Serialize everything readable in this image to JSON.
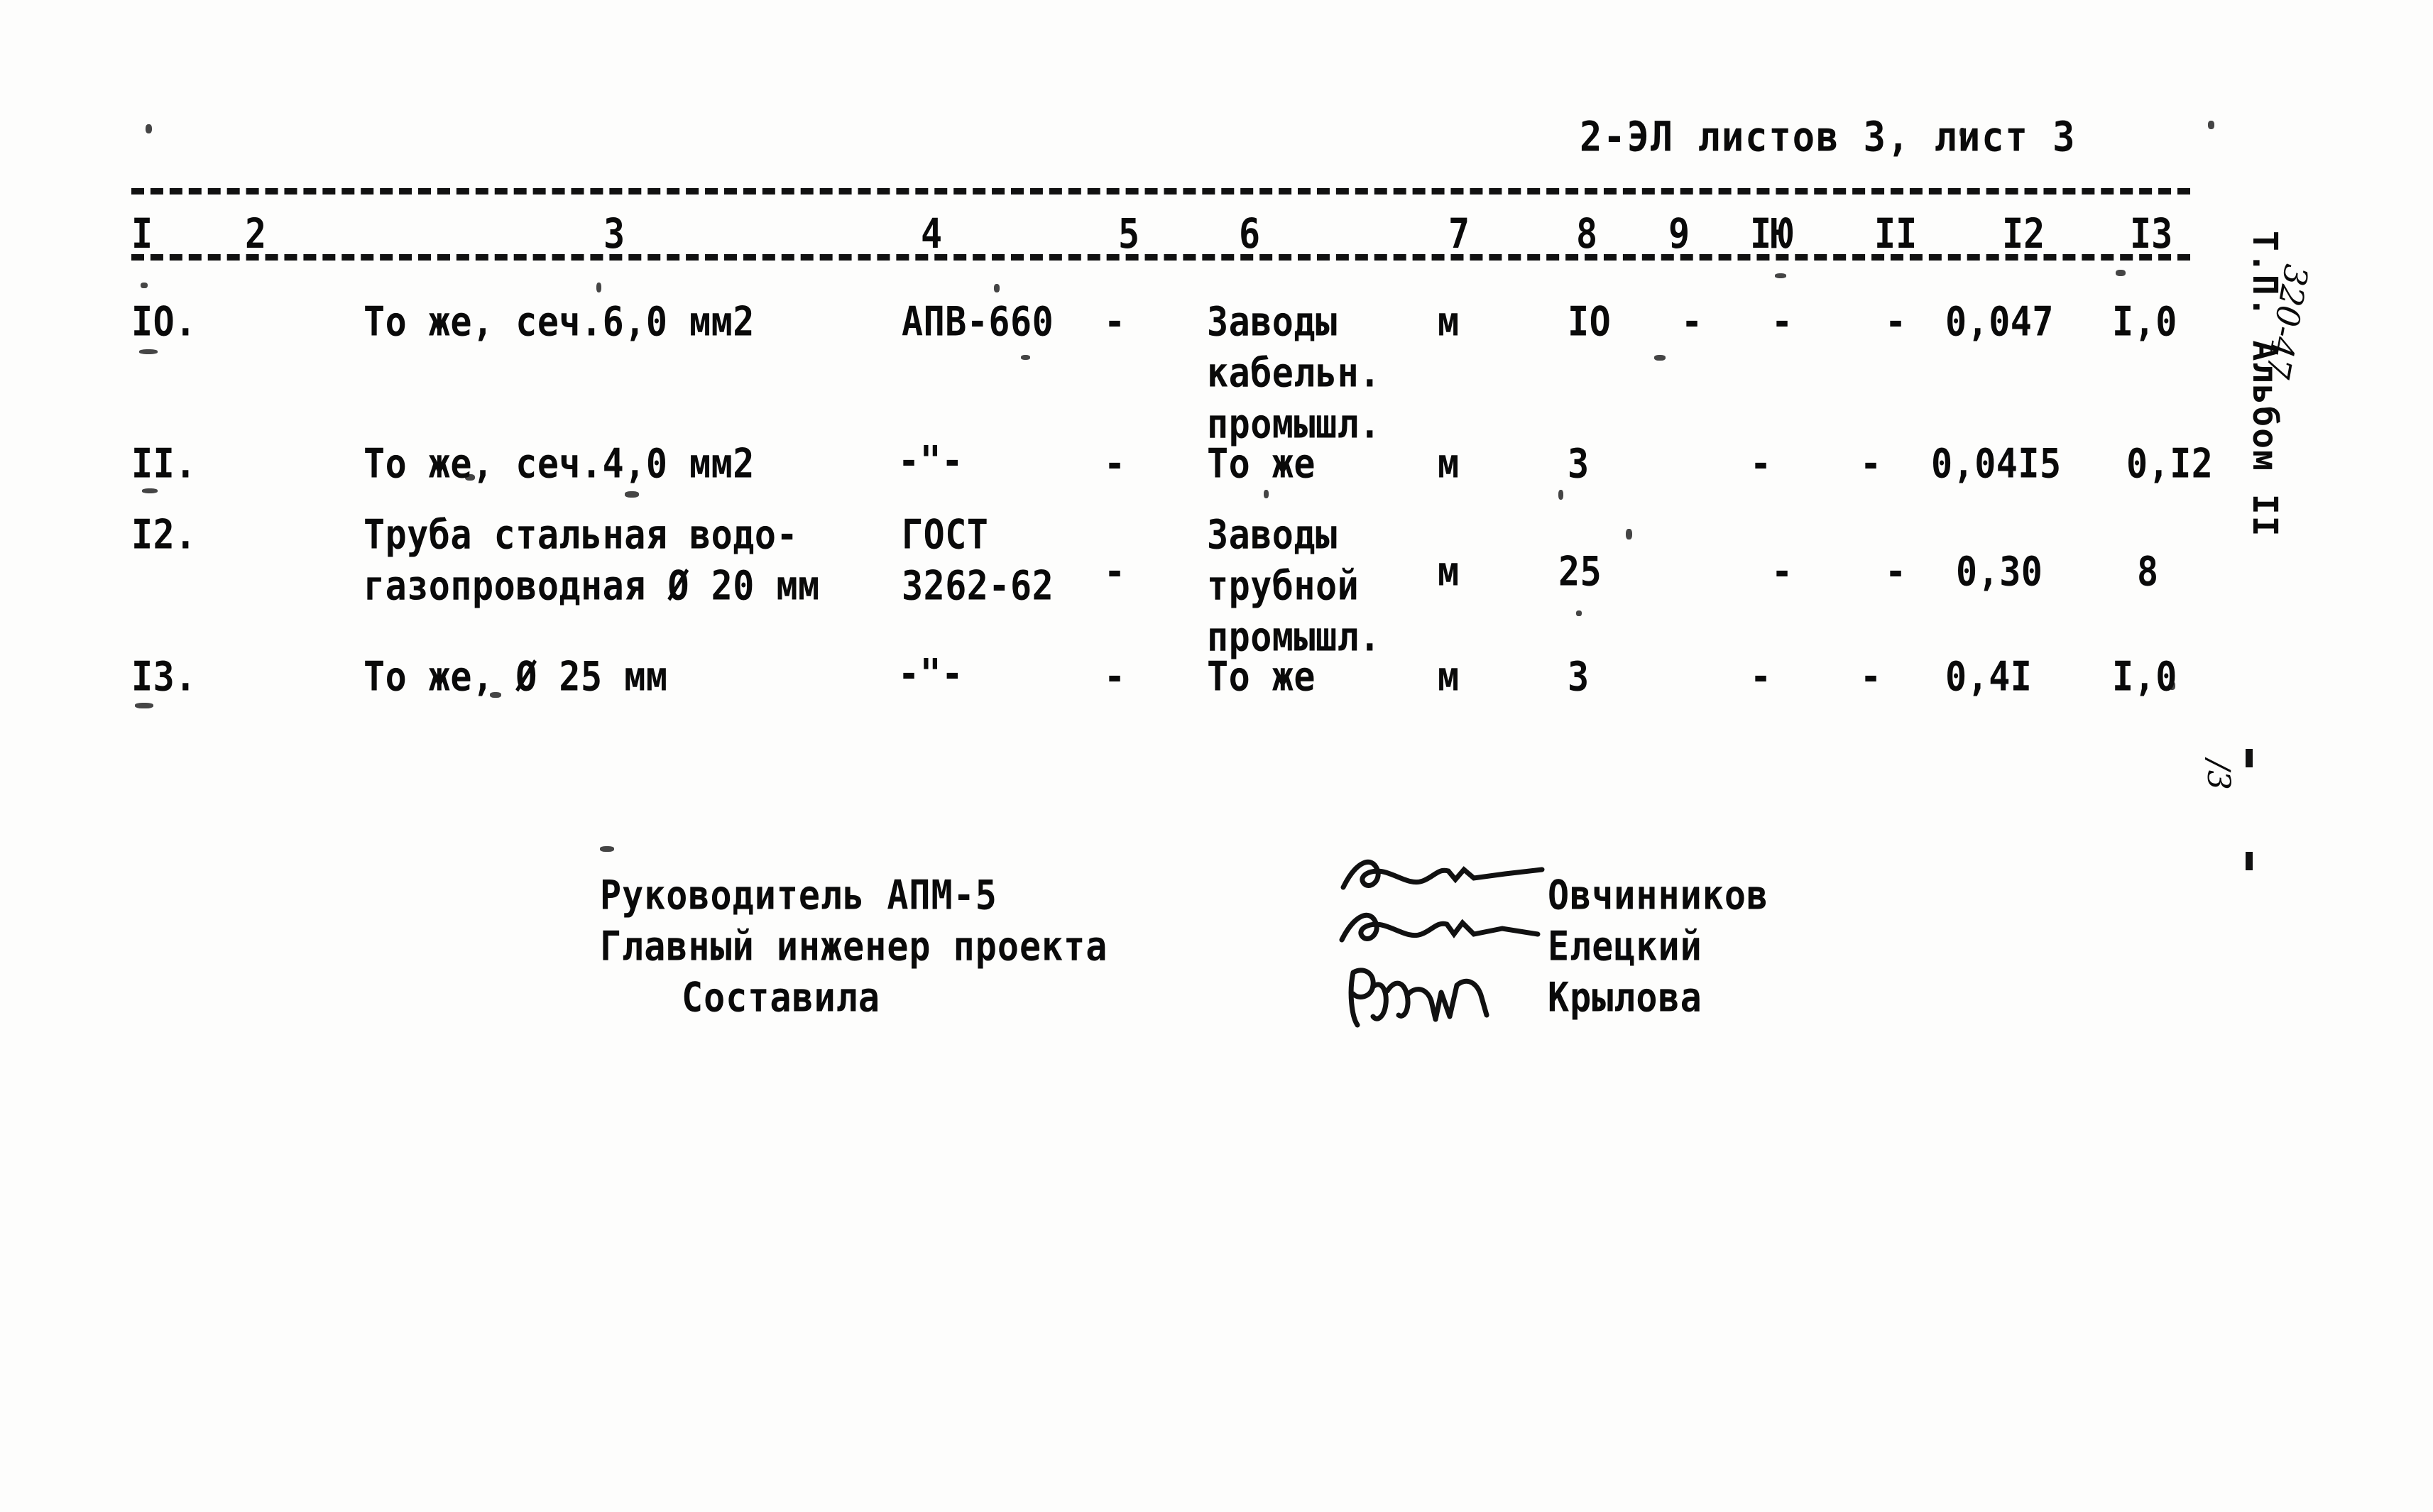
{
  "document": {
    "sheet_header": "2-ЭЛ  листов 3, лист 3",
    "margin_typed": "Т.П.  Альбом II",
    "margin_handwritten": "320-47",
    "margin_fraction": "/3"
  },
  "table": {
    "column_numbers": [
      "I",
      "2",
      "3",
      "4",
      "5",
      "6",
      "7",
      "8",
      "9",
      "IЮ",
      "II",
      "I2",
      "I3"
    ],
    "rows": [
      {
        "num": "IO.",
        "name": "То же, сеч.6,0 мм2",
        "standard": "АПВ-660",
        "c5": "-",
        "supplier": "Заводы\nкабельн.\nпромышл.",
        "unit": "м",
        "qty": "IO",
        "c9": "-",
        "c10": "-",
        "c11": "-",
        "c12": "0,047",
        "c13": "I,0"
      },
      {
        "num": "II.",
        "name": "То же, сеч.4,0 мм2",
        "standard": "-\"-",
        "c5": "-",
        "supplier": "То же",
        "unit": "м",
        "qty": "3",
        "c9": "",
        "c10": "-",
        "c11": "-",
        "c12": "0,04I5",
        "c13": "0,I2"
      },
      {
        "num": "I2.",
        "name": "Труба стальная водо-\nгазопроводная Ø 20 мм",
        "standard": "ГОСТ\n3262-62",
        "c5": "-",
        "supplier": "Заводы\nтрубной\nпромышл.",
        "unit": "м",
        "qty": "25",
        "c9": "",
        "c10": "-",
        "c11": "-",
        "c12": "0,30",
        "c13": "8"
      },
      {
        "num": "I3.",
        "name": "То же, Ø 25 мм",
        "standard": "-\"-",
        "c5": "-",
        "supplier": "То же",
        "unit": "м",
        "qty": "3",
        "c9": "",
        "c10": "-",
        "c11": "-",
        "c12": "0,4I",
        "c13": "I,0"
      }
    ]
  },
  "signatures": {
    "labels": [
      "Руководитель АПМ-5",
      "Главный инженер проекта",
      "Составила"
    ],
    "names": [
      "Овчинников",
      "Елецкий",
      "Крылова"
    ]
  }
}
